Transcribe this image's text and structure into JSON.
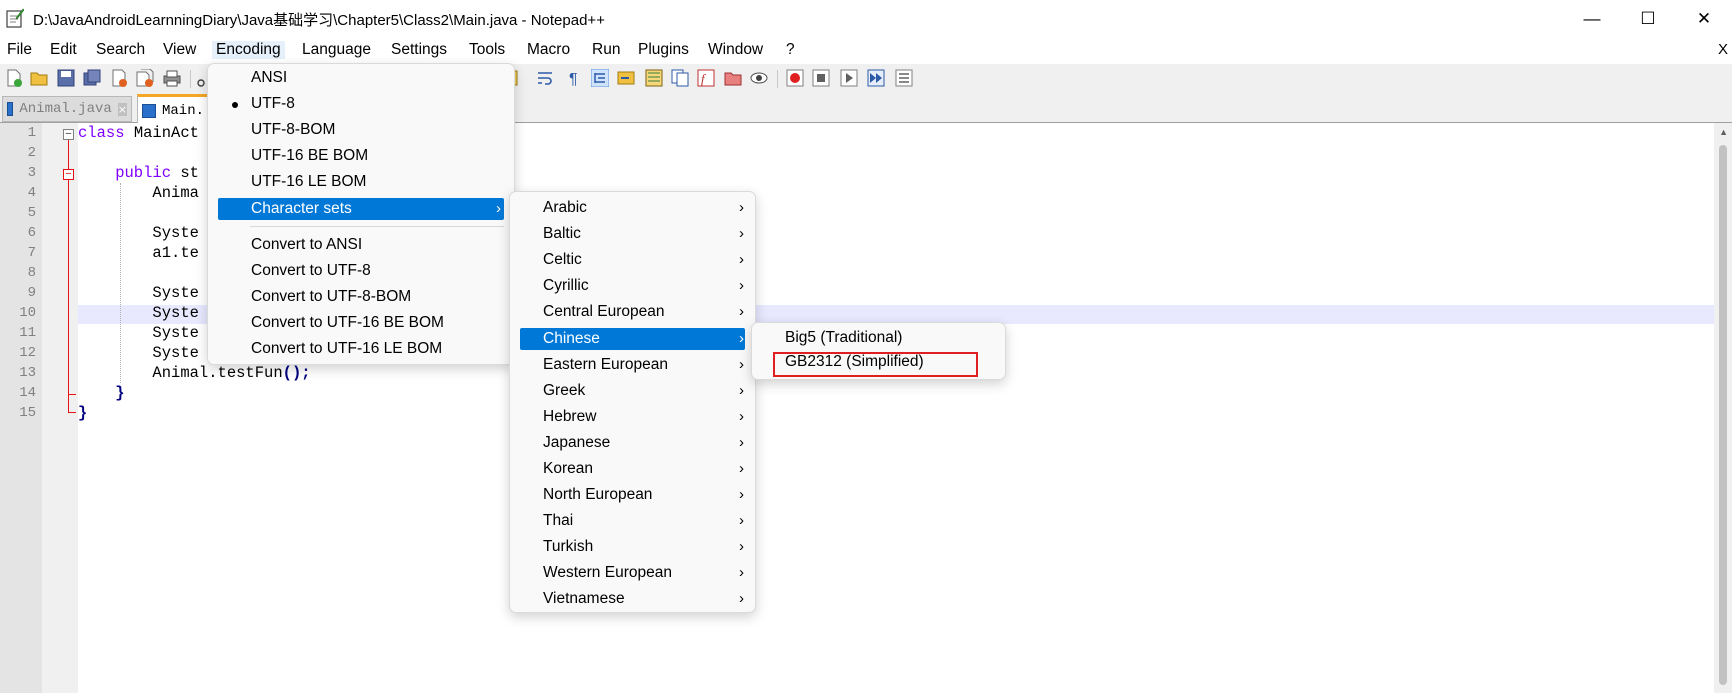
{
  "window": {
    "title": "D:\\JavaAndroidLearnningDiary\\Java基础学习\\Chapter5\\Class2\\Main.java - Notepad++",
    "minimize_glyph": "—",
    "maximize_glyph": "☐",
    "close_glyph": "✕"
  },
  "menubar": {
    "items": [
      "File",
      "Edit",
      "Search",
      "View",
      "Encoding",
      "Language",
      "Settings",
      "Tools",
      "Macro",
      "Run",
      "Plugins",
      "Window",
      "?"
    ],
    "close_label": "X",
    "open_item": "Encoding"
  },
  "tabs": [
    {
      "label": "Animal.java",
      "active": false
    },
    {
      "label": "Main.",
      "active": true
    }
  ],
  "editor": {
    "line_numbers": [
      "1",
      "2",
      "3",
      "4",
      "5",
      "6",
      "7",
      "8",
      "9",
      "10",
      "11",
      "12",
      "13",
      "14",
      "15"
    ],
    "lines": [
      {
        "kw": "class",
        "text": " MainAct"
      },
      {
        "text": ""
      },
      {
        "kw": "    public",
        "text": " st"
      },
      {
        "text": "        Anima"
      },
      {
        "text": ""
      },
      {
        "text": "        Syste"
      },
      {
        "text": "        a1.te"
      },
      {
        "text": ""
      },
      {
        "text": "        Syste"
      },
      {
        "text": "        Syste"
      },
      {
        "text": "        Syste"
      },
      {
        "text": "        Syste"
      },
      {
        "text": "        Animal.testFun",
        "tail": "();"
      },
      {
        "brace": "    }"
      },
      {
        "brace": "}"
      }
    ],
    "current_line": "10"
  },
  "encoding_menu": {
    "items": [
      {
        "label": "ANSI"
      },
      {
        "label": "UTF-8",
        "checked": true
      },
      {
        "label": "UTF-8-BOM"
      },
      {
        "label": "UTF-16 BE BOM"
      },
      {
        "label": "UTF-16 LE BOM"
      },
      {
        "label": "Character sets",
        "submenu": true,
        "highlighted": true
      },
      {
        "label": "Convert to ANSI"
      },
      {
        "label": "Convert to UTF-8"
      },
      {
        "label": "Convert to UTF-8-BOM"
      },
      {
        "label": "Convert to UTF-16 BE BOM"
      },
      {
        "label": "Convert to UTF-16 LE BOM"
      }
    ]
  },
  "charset_menu": {
    "items": [
      "Arabic",
      "Baltic",
      "Celtic",
      "Cyrillic",
      "Central European",
      "Chinese",
      "Eastern European",
      "Greek",
      "Hebrew",
      "Japanese",
      "Korean",
      "North European",
      "Thai",
      "Turkish",
      "Western European",
      "Vietnamese"
    ],
    "highlighted": "Chinese"
  },
  "chinese_menu": {
    "items": [
      "Big5 (Traditional)",
      "GB2312 (Simplified)"
    ],
    "annotated": "GB2312 (Simplified)"
  },
  "colors": {
    "menu_highlight": "#0078d7",
    "annotation_box": "#e02020",
    "keyword": "#8000ff",
    "fold_marker": "#e81010",
    "current_line": "#e8e8ff"
  },
  "toolbar": {
    "icons": [
      "new-file-icon",
      "open-file-icon",
      "save-icon",
      "save-all-icon",
      "close-icon",
      "close-all-icon",
      "print-icon",
      "cut-icon",
      "wrap-icon",
      "show-all-chars-icon",
      "indent-guide-icon",
      "udl-icon",
      "doc-map-icon",
      "function-list-icon",
      "folder-as-workspace-icon",
      "monitoring-icon",
      "record-macro-icon",
      "stop-macro-icon",
      "play-macro-icon",
      "run-macro-multiple-icon",
      "save-macro-icon"
    ]
  }
}
